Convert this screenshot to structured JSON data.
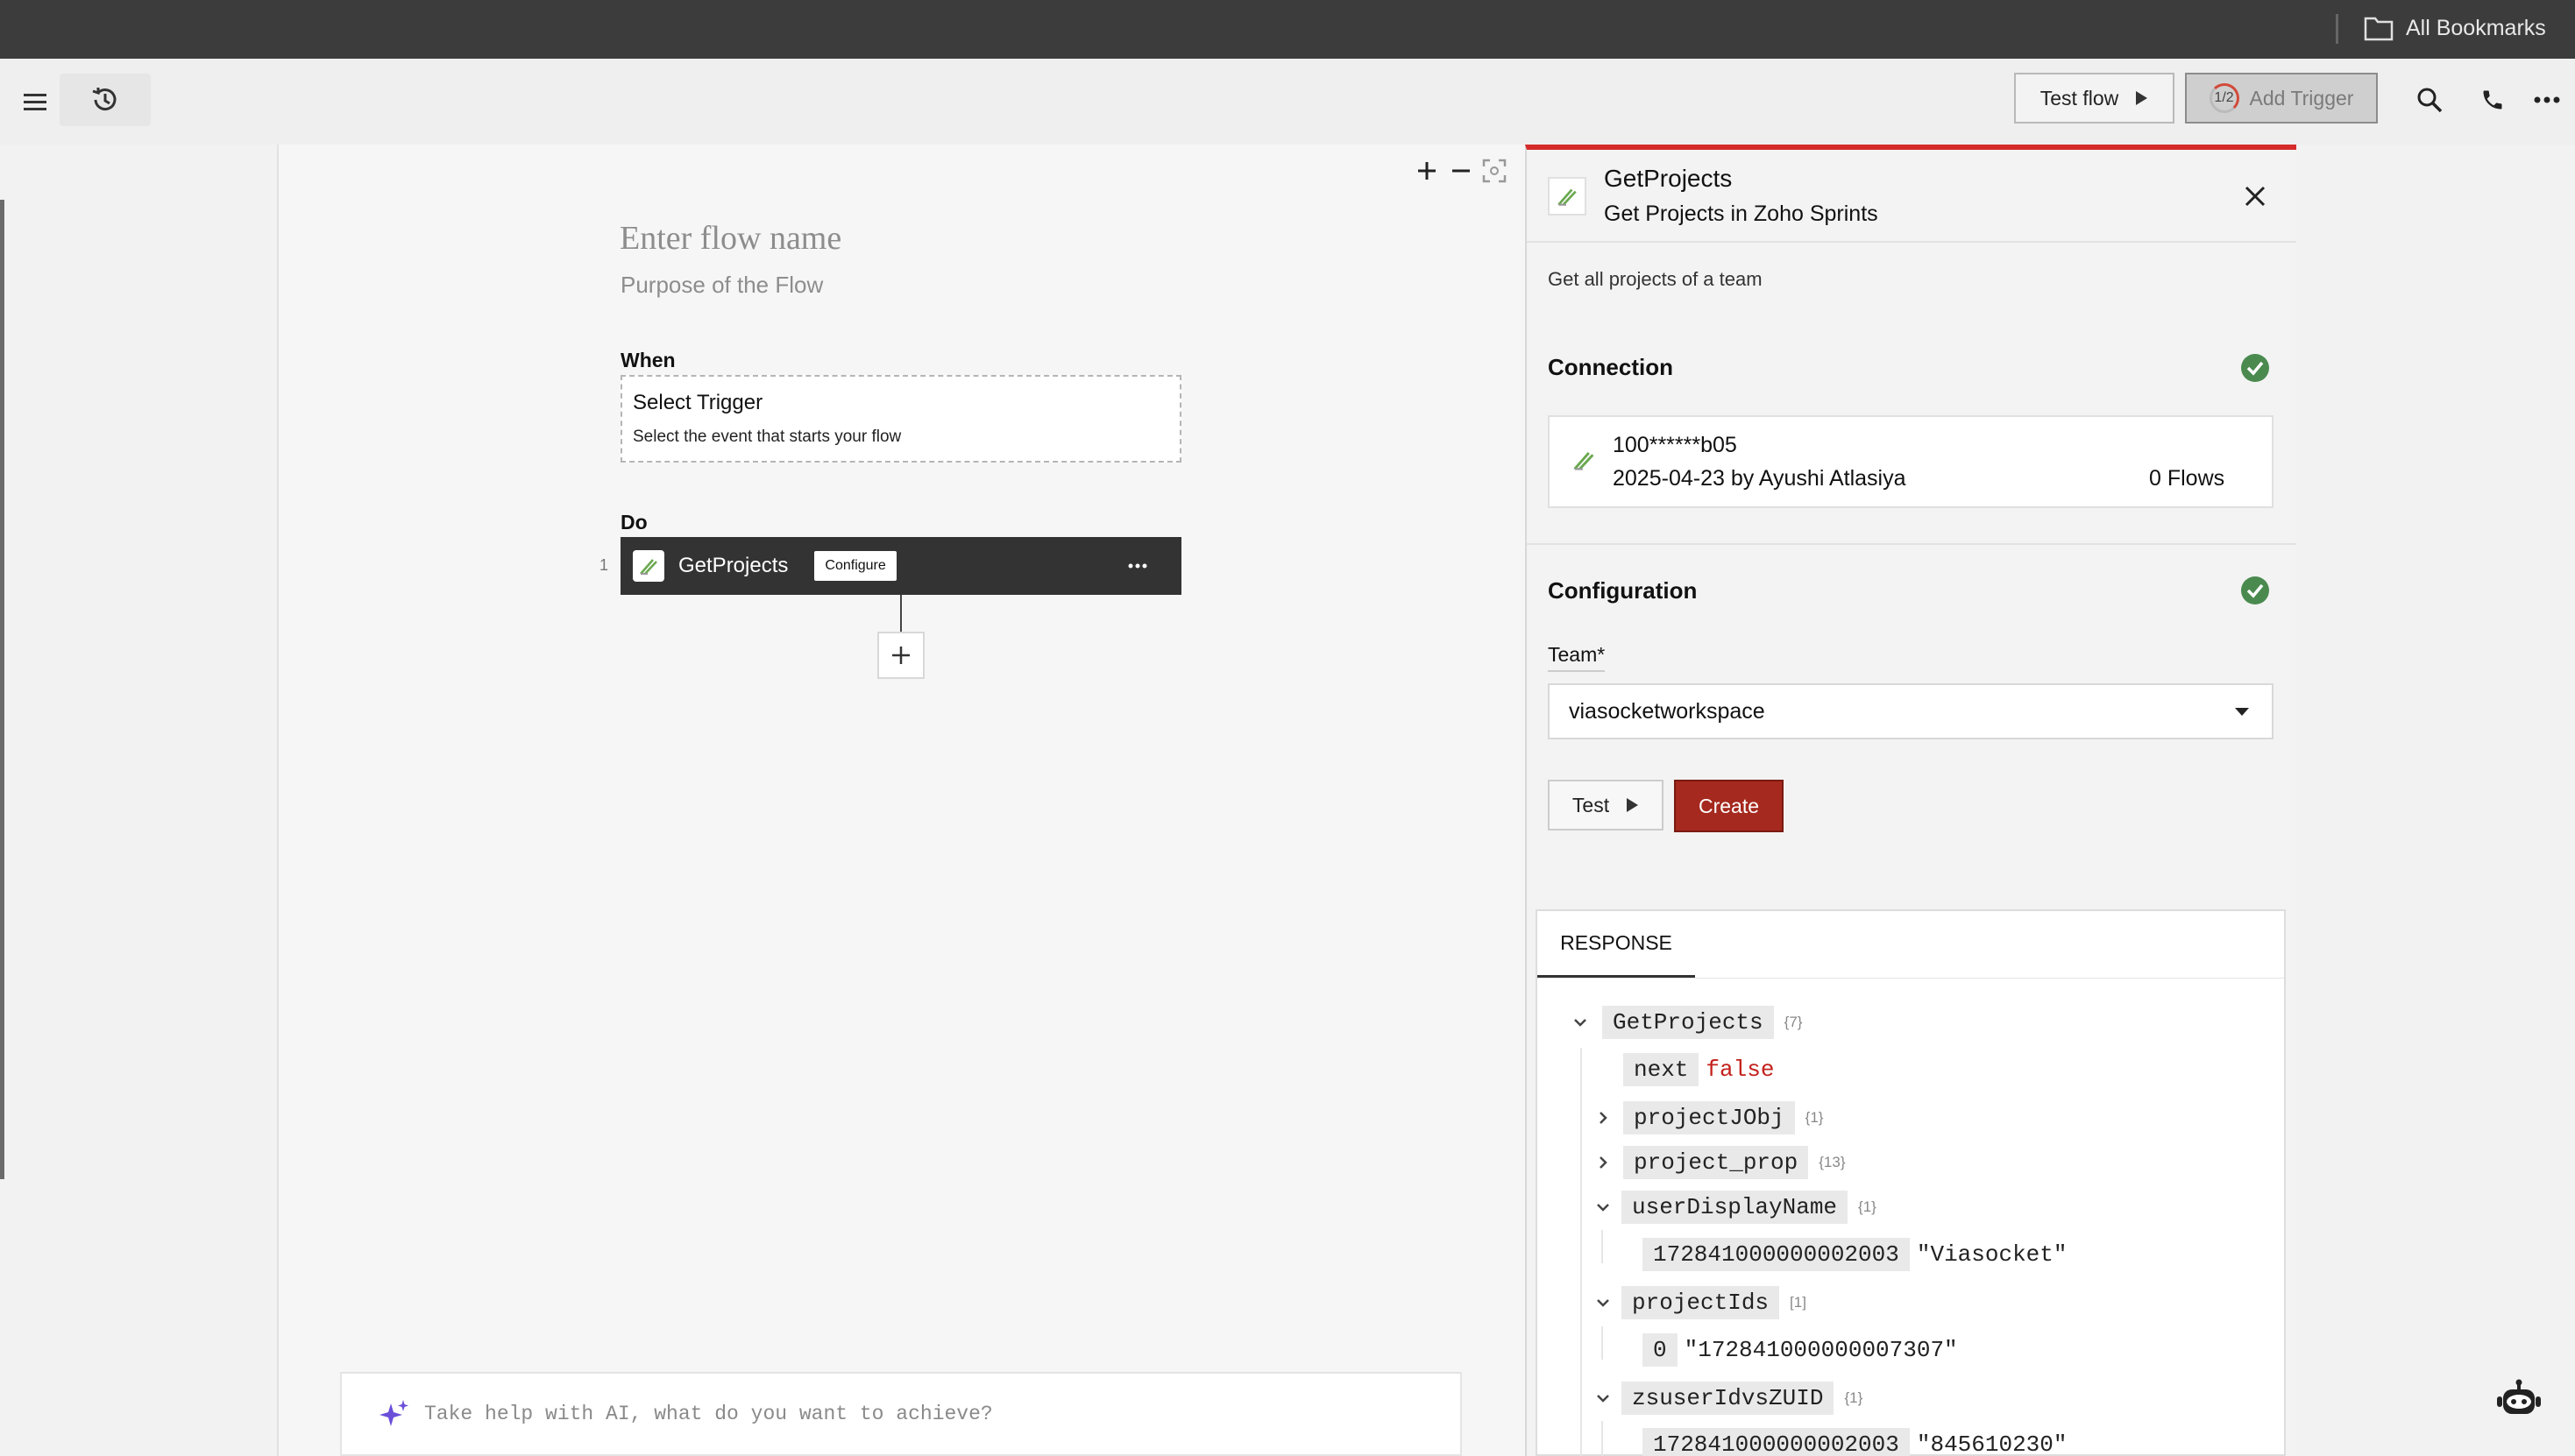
{
  "bookmarks_bar": {
    "folder_label": "All Bookmarks"
  },
  "toolbar": {
    "test_flow_label": "Test flow",
    "add_trigger_step": "1/2",
    "add_trigger_label": "Add Trigger"
  },
  "canvas": {
    "flow_name_placeholder": "Enter flow name",
    "flow_purpose_placeholder": "Purpose of the Flow",
    "when_label": "When",
    "trigger": {
      "title": "Select Trigger",
      "subtitle": "Select the event that starts your flow"
    },
    "do_label": "Do",
    "steps": [
      {
        "number": "1",
        "name": "GetProjects",
        "configure_label": "Configure"
      }
    ],
    "ai_prompt_placeholder": "Take help with AI, what do you want to achieve?"
  },
  "panel": {
    "title": "GetProjects",
    "subtitle": "Get Projects in Zoho Sprints",
    "description": "Get all projects of a team",
    "connection": {
      "title": "Connection",
      "id": "100******b05",
      "meta": "2025-04-23 by Ayushi Atlasiya",
      "flows": "0 Flows"
    },
    "configuration": {
      "title": "Configuration",
      "team_label": "Team*",
      "team_value": "viasocketworkspace"
    },
    "test_label": "Test",
    "create_label": "Create",
    "response": {
      "tab_label": "RESPONSE",
      "tree": [
        {
          "key": "GetProjects",
          "count": "{7}"
        },
        {
          "key": "next",
          "value": "false"
        },
        {
          "key": "projectJObj",
          "count": "{1}"
        },
        {
          "key": "project_prop",
          "count": "{13}"
        },
        {
          "key": "userDisplayName",
          "count": "{1}"
        },
        {
          "key": "172841000000002003",
          "value": "\"Viasocket\""
        },
        {
          "key": "projectIds",
          "count": "[1]"
        },
        {
          "key": "0",
          "value": "\"172841000000007307\""
        },
        {
          "key": "zsuserIdvsZUID",
          "count": "{1}"
        },
        {
          "key": "172841000000002003",
          "value": "\"845610230\""
        }
      ]
    }
  },
  "colors": {
    "accent_red": "#d62b2b",
    "create_button": "#a5291e",
    "success_green": "#4a8a4f",
    "bool_value": "#c4211c"
  }
}
